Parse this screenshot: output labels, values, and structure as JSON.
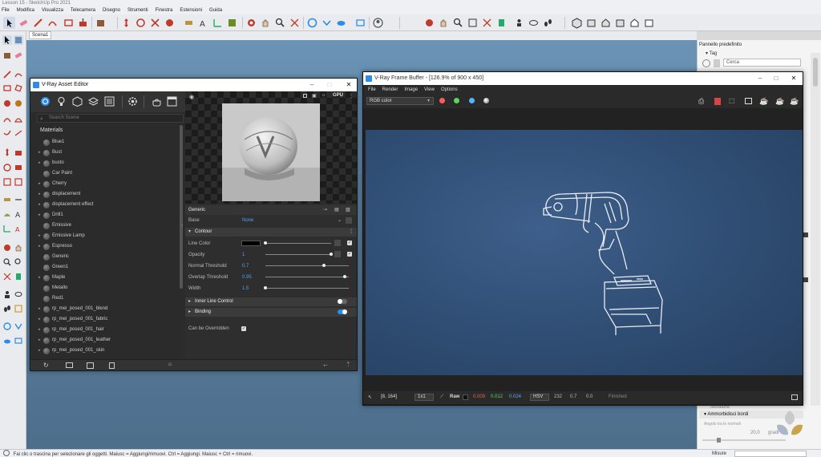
{
  "sketchup": {
    "title": "Lesson 15 - SketchUp Pro 2021",
    "menu": [
      "File",
      "Modifica",
      "Visualizza",
      "Telecamera",
      "Disegno",
      "Strumenti",
      "Finestra",
      "Estensioni",
      "Guida"
    ],
    "scene_tab": "Scena1",
    "status_text": "Fai clic o trascina per selezionare gli oggetti. Maiusc = Aggiungi/rimuovi. Ctrl = Aggiungi. Maiusc + Ctrl = rimuovi.",
    "measure_label": "Misure"
  },
  "tray": {
    "title": "Pannello predefinito",
    "tag_section": "Tag",
    "search_placeholder": "Cerca",
    "bottom_section": "Ammorbidisci bordi",
    "bottom_sub": "Angolo tra le normali",
    "angle_value": "20,0",
    "angle_unit": "gradi",
    "faded_item": "Istruttore"
  },
  "asset_editor": {
    "title": "V-Ray Asset Editor",
    "search_placeholder": "Search Scene",
    "list_header": "Materials",
    "materials": [
      {
        "name": "Blue1",
        "expandable": false
      },
      {
        "name": "Bust",
        "expandable": true
      },
      {
        "name": "busto",
        "expandable": true
      },
      {
        "name": "Car Paint",
        "expandable": false
      },
      {
        "name": "Cherry",
        "expandable": true
      },
      {
        "name": "displacement",
        "expandable": true
      },
      {
        "name": "displacement effect",
        "expandable": true
      },
      {
        "name": "Drill1",
        "expandable": true
      },
      {
        "name": "Emissive",
        "expandable": false
      },
      {
        "name": "Emissive Lamp",
        "expandable": true
      },
      {
        "name": "Espresso",
        "expandable": true
      },
      {
        "name": "Generic",
        "expandable": false
      },
      {
        "name": "Green1",
        "expandable": false
      },
      {
        "name": "Maple",
        "expandable": true
      },
      {
        "name": "Metallo",
        "expandable": false
      },
      {
        "name": "Red1",
        "expandable": false
      },
      {
        "name": "rp_mei_posed_001_blend",
        "expandable": true
      },
      {
        "name": "rp_mei_posed_001_fabric",
        "expandable": true
      },
      {
        "name": "rp_mei_posed_001_hair",
        "expandable": true
      },
      {
        "name": "rp_mei_posed_001_leather",
        "expandable": true
      },
      {
        "name": "rp_mei_posed_001_skin",
        "expandable": true
      }
    ],
    "preview_badge": "GPU",
    "generic_header": "Generic",
    "base_label": "Base",
    "base_value": "None",
    "contour_section": "Contour",
    "props": {
      "line_color_label": "Line Color",
      "opacity_label": "Opacity",
      "opacity_value": "1",
      "normal_threshold_label": "Normal Threshold",
      "normal_threshold_value": "0.7",
      "overlap_threshold_label": "Overlap Threshold",
      "overlap_threshold_value": "0.95",
      "width_label": "Width",
      "width_value": "1.5"
    },
    "slider_levels": {
      "line_color": 0.0,
      "opacity": 1.0,
      "normal_threshold": 0.7,
      "overlap_threshold": 0.95,
      "width": 0.0
    },
    "inner_line_control": "Inner Line Control",
    "binding": "Binding",
    "can_be_overridden": "Can be Overridden",
    "inner_line_enabled": false,
    "binding_enabled": true
  },
  "frame_buffer": {
    "title": "V-Ray Frame Buffer - [126.9% of 900 x 450]",
    "menu": [
      "File",
      "Render",
      "Image",
      "View",
      "Options"
    ],
    "channel": "RGB color",
    "status": {
      "coords": "[8, 164]",
      "zoom": "1x1",
      "raw_label": "Raw",
      "r": "0.009",
      "g": "0.012",
      "b": "0.024",
      "mode": "HSV",
      "h": "232",
      "s": "0.7",
      "v": "0.0",
      "finished": "Finished"
    }
  },
  "colors": {
    "accent_blue": "#2d8ce6",
    "ae_bg": "#2b2b2b",
    "viewport_sky": "#5f86a7"
  }
}
